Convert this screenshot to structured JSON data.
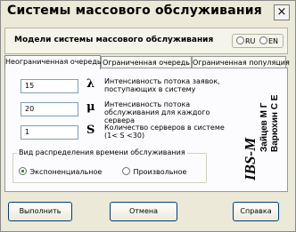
{
  "window": {
    "title": "Системы массового обслуживания",
    "close_label": "×"
  },
  "header": {
    "models_label": "Модели системы массового обслуживания",
    "lang_options": [
      {
        "label": "RU",
        "selected": false
      },
      {
        "label": "EN",
        "selected": false
      }
    ]
  },
  "tabs": [
    {
      "label": "Неограниченная очередь",
      "active": true
    },
    {
      "label": "Ограниченная очередь",
      "active": false
    },
    {
      "label": "Ограниченная популяция",
      "active": false
    }
  ],
  "params": [
    {
      "value": "15",
      "symbol": "λ",
      "description": "Интенсивность потока заявок, поступающих в систему"
    },
    {
      "value": "20",
      "symbol": "μ",
      "description": "Интенсивность потока обслуживания для каждого сервера"
    },
    {
      "value": "1",
      "symbol": "S",
      "description": "Количество серверов в системе (1< S <30)"
    }
  ],
  "distribution": {
    "title": "Вид распределения времени обслуживания",
    "options": [
      {
        "label": "Экспоненциальное",
        "selected": true
      },
      {
        "label": "Произвольное",
        "selected": false
      }
    ]
  },
  "logo": {
    "brand": "IBS-M",
    "authors": [
      "Зайцев М Г",
      "Варюхин С Е"
    ]
  },
  "buttons": {
    "run": "Выполнить",
    "cancel": "Отмена",
    "help": "Справка"
  }
}
